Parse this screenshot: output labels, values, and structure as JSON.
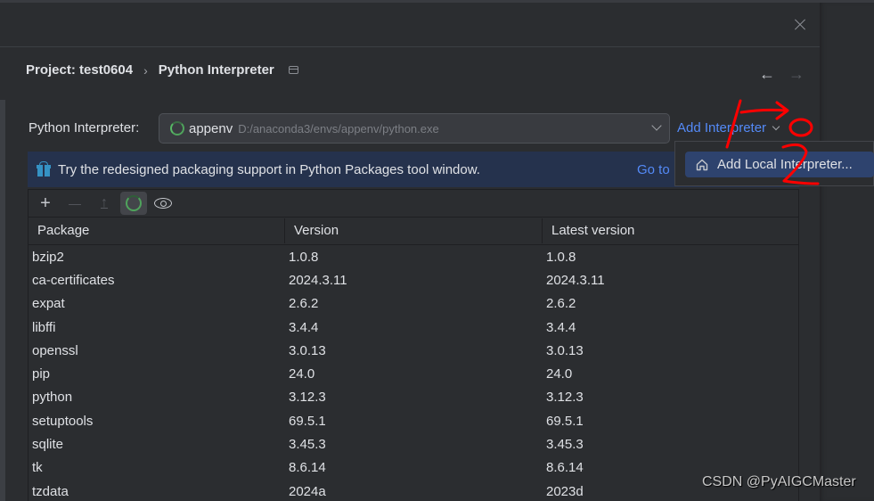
{
  "dialog": {
    "breadcrumb": {
      "project": "Project: test0604",
      "separator": "›",
      "page": "Python Interpreter"
    },
    "nav": {
      "back": "←",
      "forward": "→"
    }
  },
  "interpreter": {
    "label": "Python Interpreter:",
    "env_name": "appenv",
    "env_path": "D:/anaconda3/envs/appenv/python.exe",
    "add_button": "Add Interpreter"
  },
  "dropdown": {
    "items": [
      {
        "label": "Add Local Interpreter...",
        "icon": "home-icon"
      }
    ]
  },
  "banner": {
    "text": "Try the redesigned packaging support in Python Packages tool window.",
    "link": "Go to"
  },
  "toolbar": {
    "add": "+",
    "remove": "—",
    "upgrade": "↑"
  },
  "table": {
    "columns": [
      "Package",
      "Version",
      "Latest version"
    ],
    "rows": [
      {
        "package": "bzip2",
        "version": "1.0.8",
        "latest": "1.0.8"
      },
      {
        "package": "ca-certificates",
        "version": "2024.3.11",
        "latest": "2024.3.11"
      },
      {
        "package": "expat",
        "version": "2.6.2",
        "latest": "2.6.2"
      },
      {
        "package": "libffi",
        "version": "3.4.4",
        "latest": "3.4.4"
      },
      {
        "package": "openssl",
        "version": "3.0.13",
        "latest": "3.0.13"
      },
      {
        "package": "pip",
        "version": "24.0",
        "latest": "24.0"
      },
      {
        "package": "python",
        "version": "3.12.3",
        "latest": "3.12.3"
      },
      {
        "package": "setuptools",
        "version": "69.5.1",
        "latest": "69.5.1"
      },
      {
        "package": "sqlite",
        "version": "3.45.3",
        "latest": "3.45.3"
      },
      {
        "package": "tk",
        "version": "8.6.14",
        "latest": "8.6.14"
      },
      {
        "package": "tzdata",
        "version": "2024a",
        "latest": "2023d"
      }
    ]
  },
  "watermark": "CSDN @PyAIGCMaster",
  "colors": {
    "background": "#2b2d30",
    "link": "#548af7",
    "banner": "#25324d",
    "selection": "#2e436e",
    "annotation": "#ff0000"
  }
}
